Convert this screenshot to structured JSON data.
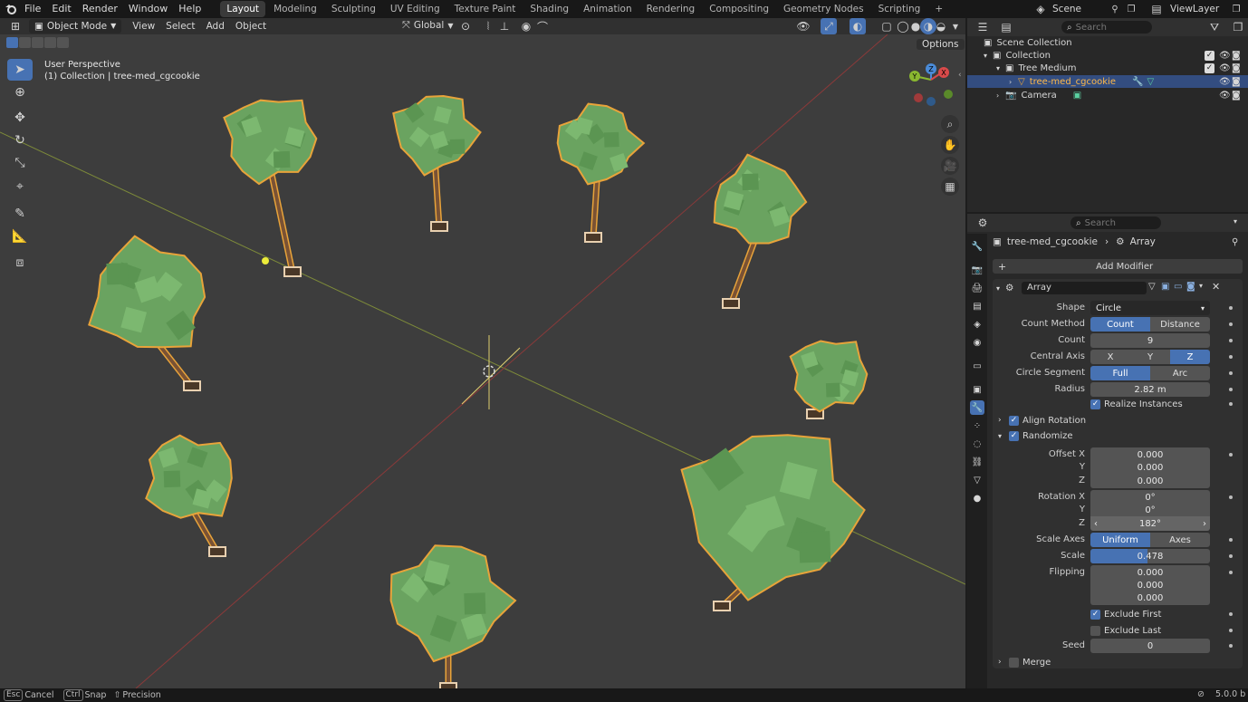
{
  "topbar": {
    "menus": [
      "File",
      "Edit",
      "Render",
      "Window",
      "Help"
    ],
    "workspaces": [
      "Layout",
      "Modeling",
      "Sculpting",
      "UV Editing",
      "Texture Paint",
      "Shading",
      "Animation",
      "Rendering",
      "Compositing",
      "Geometry Nodes",
      "Scripting"
    ],
    "active_workspace": "Layout",
    "add_tab": "+",
    "scene_label": "Scene",
    "viewlayer_label": "ViewLayer"
  },
  "viewport_header": {
    "mode": "Object Mode",
    "menus": [
      "View",
      "Select",
      "Add",
      "Object"
    ],
    "orientation": "Global",
    "options": "Options"
  },
  "viewport": {
    "perspective_label": "User Perspective",
    "collection_label": "(1) Collection | tree-med_cgcookie",
    "gizmo_axes": [
      "X",
      "Y",
      "Z"
    ]
  },
  "outliner": {
    "search_placeholder": "Search",
    "scene_collection": "Scene Collection",
    "items": [
      {
        "label": "Collection",
        "depth": 1
      },
      {
        "label": "Tree Medium",
        "depth": 2
      },
      {
        "label": "tree-med_cgcookie",
        "depth": 3,
        "selected": true
      },
      {
        "label": "Camera",
        "depth": 2
      }
    ]
  },
  "properties": {
    "search_placeholder": "Search",
    "breadcrumb_object": "tree-med_cgcookie",
    "breadcrumb_modifier": "Array",
    "add_modifier": "Add Modifier",
    "modifier_name": "Array",
    "shape_label": "Shape",
    "shape_value": "Circle",
    "count_method_label": "Count Method",
    "count_method_options": [
      "Count",
      "Distance"
    ],
    "count_label": "Count",
    "count_value": "9",
    "central_axis_label": "Central Axis",
    "central_axis_options": [
      "X",
      "Y",
      "Z"
    ],
    "circle_segment_label": "Circle Segment",
    "circle_segment_options": [
      "Full",
      "Arc"
    ],
    "radius_label": "Radius",
    "radius_value": "2.82 m",
    "realize_instances": "Realize Instances",
    "align_rotation": "Align Rotation",
    "randomize": "Randomize",
    "offset_x_label": "Offset X",
    "offset_x": "0.000",
    "offset_y_label": "Y",
    "offset_y": "0.000",
    "offset_z_label": "Z",
    "offset_z": "0.000",
    "rotation_x_label": "Rotation X",
    "rotation_x": "0°",
    "rotation_y_label": "Y",
    "rotation_y": "0°",
    "rotation_z_label": "Z",
    "rotation_z": "182°",
    "scale_axes_label": "Scale Axes",
    "scale_axes_options": [
      "Uniform",
      "Axes"
    ],
    "scale_label": "Scale",
    "scale_value": "0.478",
    "flipping_label": "Flipping",
    "flipping_values": [
      "0.000",
      "0.000",
      "0.000"
    ],
    "exclude_first": "Exclude First",
    "exclude_last": "Exclude Last",
    "seed_label": "Seed",
    "seed_value": "0",
    "merge": "Merge"
  },
  "statusbar": {
    "cancel_key": "Esc",
    "cancel": "Cancel",
    "snap_key": "Ctrl",
    "snap": "Snap",
    "precision": "Precision",
    "version": "5.0.0 b"
  },
  "colors": {
    "accent": "#4772b3",
    "tree_foliage": "#6aa360",
    "tree_outline": "#e8a33a",
    "trunk": "#7a5234"
  }
}
